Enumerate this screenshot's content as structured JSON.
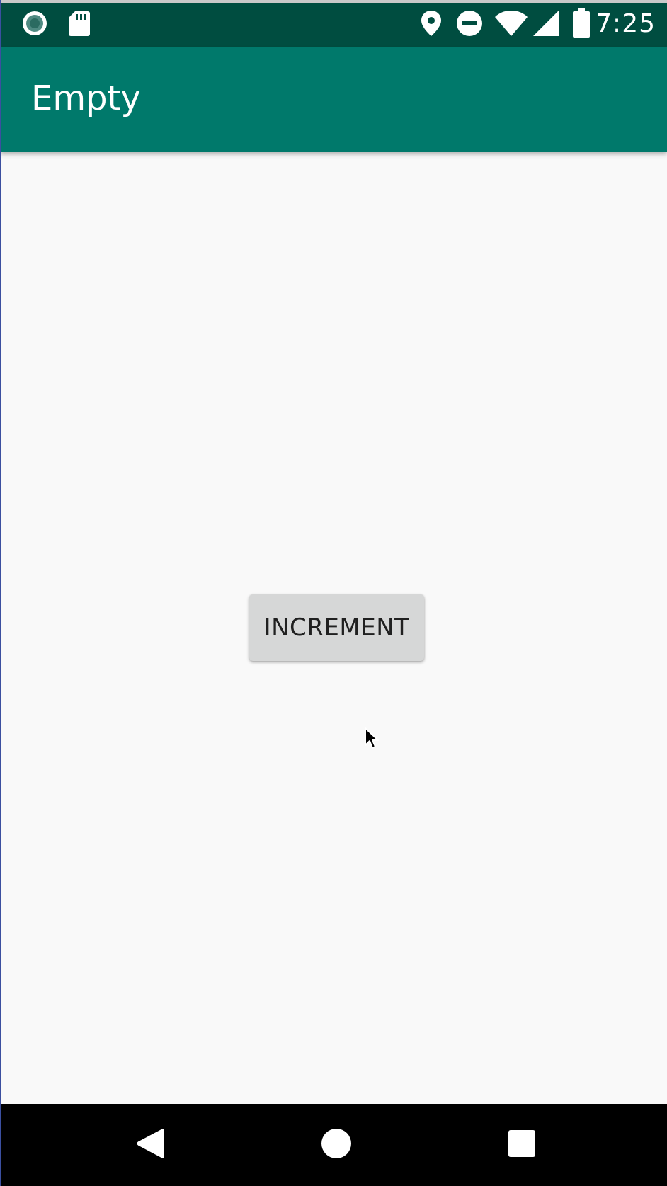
{
  "status_bar": {
    "time": "7:25",
    "left_icons": [
      "record-icon",
      "sd-card-icon"
    ],
    "right_icons": [
      "location-icon",
      "do-not-disturb-icon",
      "wifi-icon",
      "cell-signal-icon",
      "battery-icon"
    ],
    "background_color": "#004d40"
  },
  "app_bar": {
    "title": "Empty",
    "background_color": "#00796b"
  },
  "main": {
    "increment_button_label": "INCREMENT",
    "background_color": "#f9f9f9"
  },
  "nav_bar": {
    "buttons": [
      "back-icon",
      "home-icon",
      "recents-icon"
    ]
  }
}
